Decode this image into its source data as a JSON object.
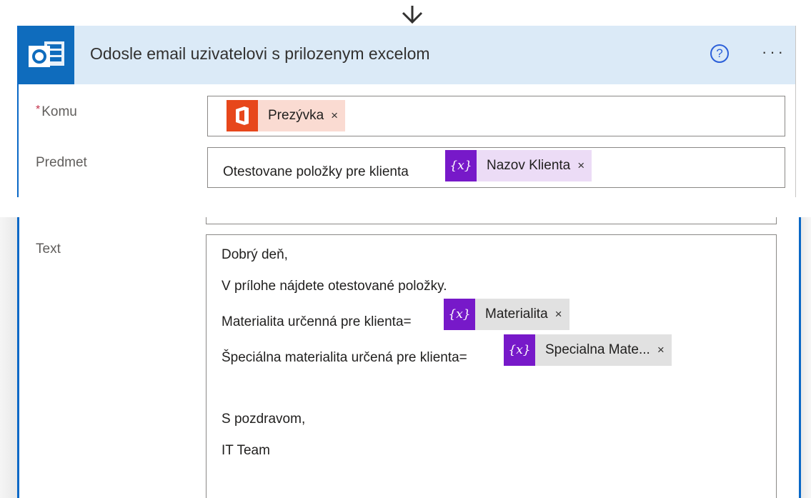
{
  "flow_arrow": "down-arrow-icon",
  "action": {
    "title": "Odosle email uzivatelovi s prilozenym excelom",
    "app_icon": "outlook-icon",
    "help_icon": "?",
    "more_icon": "···"
  },
  "fields": {
    "to": {
      "required_mark": "*",
      "label": "Komu",
      "token": {
        "icon": "office-icon",
        "label": "Prezývka",
        "remove": "×"
      }
    },
    "subject": {
      "label": "Predmet",
      "prefix": "Otestovane položky pre klienta",
      "token": {
        "icon": "{x}",
        "label": "Nazov Klienta",
        "remove": "×"
      }
    },
    "body": {
      "label": "Text",
      "line1": "Dobrý deň,",
      "line2": "V prílohe nájdete otestované položky.",
      "line3": "Materialita určenná pre klienta=",
      "token1": {
        "icon": "{x}",
        "label": "Materialita",
        "remove": "×"
      },
      "line4": "Špeciálna materialita určená pre klienta=",
      "token2": {
        "icon": "{x}",
        "label": "Specialna Mate...",
        "remove": "×"
      },
      "line5": "S pozdravom,",
      "line6": "IT Team"
    }
  },
  "colors": {
    "accent": "#0f6cbd",
    "header_bg": "#dbeaf7",
    "variable_token": "#7719c9",
    "office_token": "#e7471b"
  }
}
